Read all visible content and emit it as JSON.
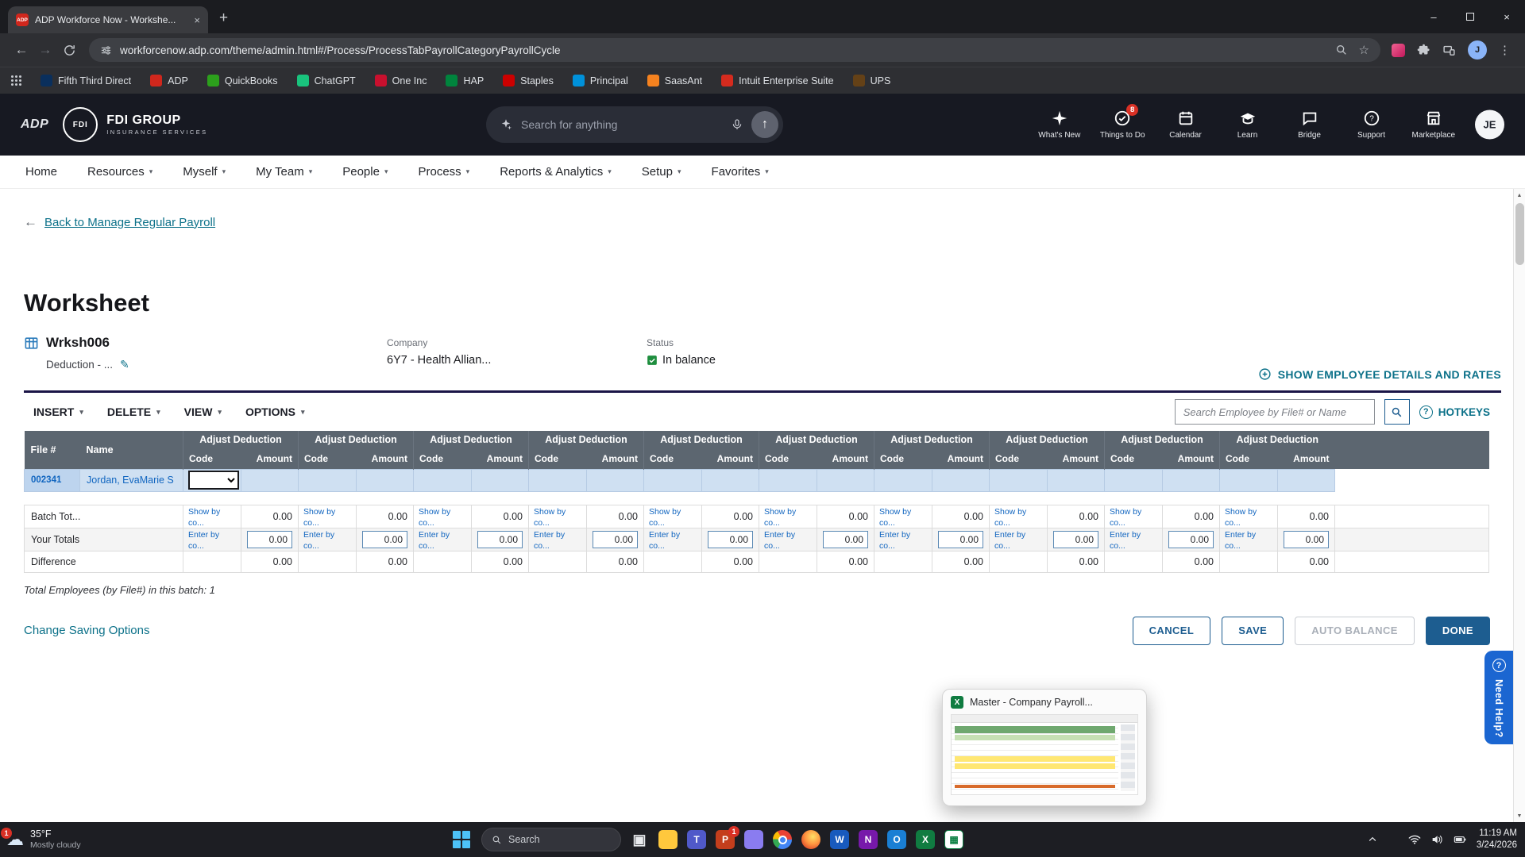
{
  "browser": {
    "tab_title": "ADP Workforce Now - Workshe...",
    "url": "workforcenow.adp.com/theme/admin.html#/Process/ProcessTabPayrollCategoryPayrollCycle",
    "bookmarks": [
      {
        "label": "Fifth Third Direct",
        "color": "#0A2F5C"
      },
      {
        "label": "ADP",
        "color": "#D0271D"
      },
      {
        "label": "QuickBooks",
        "color": "#2CA01C"
      },
      {
        "label": "ChatGPT",
        "color": "#19C37D"
      },
      {
        "label": "One Inc",
        "color": "#C8102E"
      },
      {
        "label": "HAP",
        "color": "#00843D"
      },
      {
        "label": "Staples",
        "color": "#CC0000"
      },
      {
        "label": "Principal",
        "color": "#0091DA"
      },
      {
        "label": "SaasAnt",
        "color": "#F5821F"
      },
      {
        "label": "Intuit Enterprise Suite",
        "color": "#D52B1E"
      },
      {
        "label": "UPS",
        "color": "#644117"
      }
    ]
  },
  "header": {
    "logo": "ADP",
    "brand": "FDI GROUP",
    "brand_abbr": "FDI",
    "tagline": "INSURANCE SERVICES",
    "search_placeholder": "Search for anything",
    "avatar": "JE",
    "items": [
      {
        "label": "What's New",
        "icon": "whats-new"
      },
      {
        "label": "Things to Do",
        "icon": "things-to-do",
        "badge": "8"
      },
      {
        "label": "Calendar",
        "icon": "calendar"
      },
      {
        "label": "Learn",
        "icon": "learn"
      },
      {
        "label": "Bridge",
        "icon": "bridge"
      },
      {
        "label": "Support",
        "icon": "support"
      },
      {
        "label": "Marketplace",
        "icon": "marketplace"
      }
    ]
  },
  "menu": {
    "items": [
      {
        "label": "Home",
        "caret": false
      },
      {
        "label": "Resources",
        "caret": true
      },
      {
        "label": "Myself",
        "caret": true
      },
      {
        "label": "My Team",
        "caret": true
      },
      {
        "label": "People",
        "caret": true
      },
      {
        "label": "Process",
        "caret": true
      },
      {
        "label": "Reports & Analytics",
        "caret": true
      },
      {
        "label": "Setup",
        "caret": true
      },
      {
        "label": "Favorites",
        "caret": true
      }
    ]
  },
  "page": {
    "back_link": "Back to Manage Regular Payroll",
    "title": "Worksheet",
    "worksheet_name": "Wrksh006",
    "worksheet_subtitle": "Deduction - ...",
    "company_label": "Company",
    "company_value": "6Y7 - Health Allian...",
    "status_label": "Status",
    "status_value": "In balance",
    "show_details": "SHOW EMPLOYEE DETAILS AND RATES"
  },
  "panel": {
    "menus": [
      {
        "label": "INSERT"
      },
      {
        "label": "DELETE"
      },
      {
        "label": "VIEW"
      },
      {
        "label": "OPTIONS"
      }
    ],
    "search_placeholder": "Search Employee by File# or Name",
    "hotkeys": "HOTKEYS"
  },
  "table": {
    "num_groups": 10,
    "col_file": "File #",
    "col_name": "Name",
    "group_header": "Adjust Deduction",
    "col_code": "Code",
    "col_amount": "Amount",
    "employee": {
      "file": "002341",
      "name": "Jordan, EvaMarie S"
    },
    "batch_label": "Batch Tot...",
    "your_label": "Your Totals",
    "diff_label": "Difference",
    "show_by": "Show by co...",
    "enter_by": "Enter by co...",
    "zero": "0.00",
    "total_note": "Total Employees (by File#) in this batch: 1"
  },
  "footer": {
    "change_saving": "Change Saving Options",
    "cancel": "CANCEL",
    "save": "SAVE",
    "auto_balance": "AUTO BALANCE",
    "done": "DONE"
  },
  "help_tab": {
    "label": "Need Help?"
  },
  "floating": {
    "title": "Master - Company Payroll..."
  },
  "taskbar": {
    "weather_temp": "35°F",
    "weather_desc": "Mostly cloudy",
    "weather_badge": "1",
    "search_placeholder": "Search",
    "time": "11:19 AM",
    "date": "3/24/2026",
    "apps": [
      {
        "name": "task-view",
        "bg": "transparent",
        "fg": "#E8EAED",
        "glyph": "▣"
      },
      {
        "name": "file-explorer",
        "bg": "#FFC83D",
        "glyph": ""
      },
      {
        "name": "teams",
        "bg": "#5059C9",
        "glyph": "T"
      },
      {
        "name": "powerpoint",
        "bg": "#C43E1C",
        "glyph": "P",
        "badge": "1"
      },
      {
        "name": "loop",
        "bg": "#8A7CF0",
        "glyph": ""
      },
      {
        "name": "chrome",
        "bg": "conic-gradient(from -30deg,#EA4335 0 33%,#4285F4 33% 66%,#34A853 66% 84%,#FBBC05 84% 100%)",
        "glyph": ""
      },
      {
        "name": "firefox",
        "bg": "radial-gradient(circle at 60% 35%,#FFE066 0%,#FF9640 45%,#E4572E 75%,#B5321A 100%)",
        "glyph": ""
      },
      {
        "name": "word",
        "bg": "#185ABD",
        "glyph": "W"
      },
      {
        "name": "onenote",
        "bg": "#7719AA",
        "glyph": "N"
      },
      {
        "name": "outlook",
        "bg": "#1A7FD4",
        "glyph": "O"
      },
      {
        "name": "excel",
        "bg": "#107C41",
        "glyph": "X"
      },
      {
        "name": "sheets",
        "bg": "#FFFFFF",
        "fg": "#0C8043",
        "glyph": "▦",
        "border": "1px solid #0C8043"
      }
    ]
  }
}
